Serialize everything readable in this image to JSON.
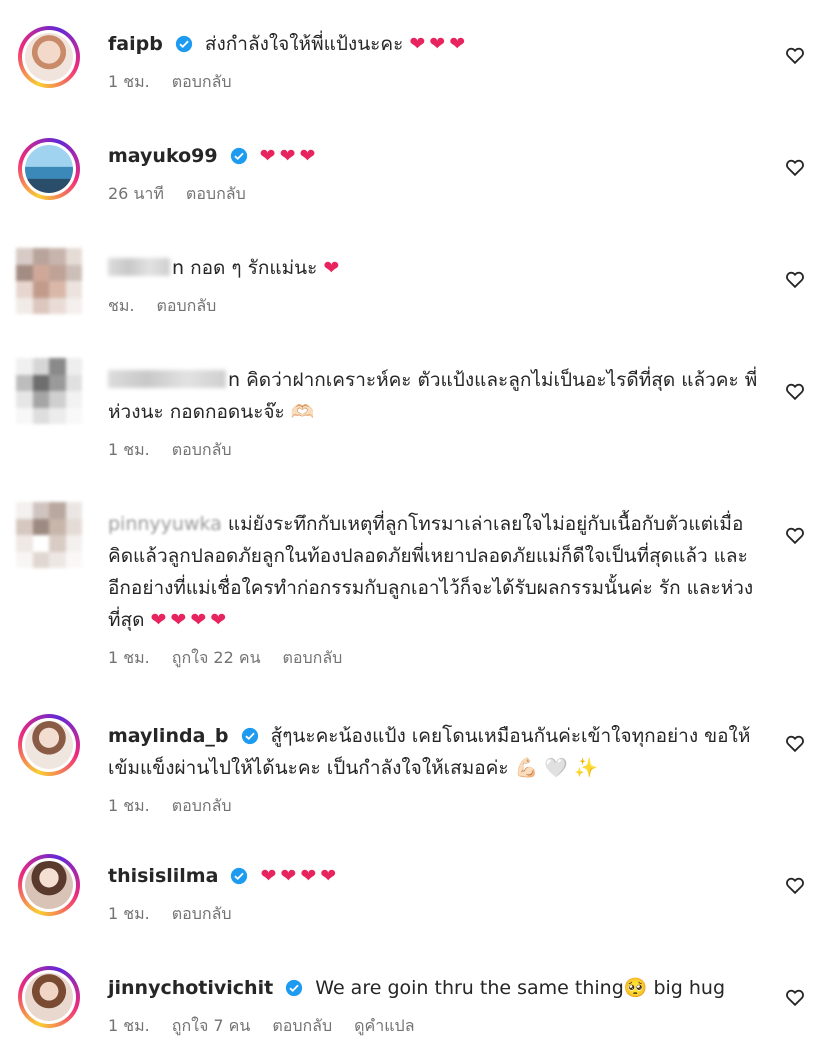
{
  "colors": {
    "heart": "#e8245e",
    "verified": "#1d9bf0",
    "meta": "#737373"
  },
  "comments": [
    {
      "username": "faipb",
      "verified": true,
      "text": "ส่งกำลังใจให้พี่แป้งนะคะ",
      "hearts": "❤❤❤",
      "time": "1 ชม.",
      "likes": "",
      "reply": "ตอบกลับ"
    },
    {
      "username": "mayuko99",
      "verified": true,
      "text": "",
      "hearts": "❤❤❤",
      "time": "26 นาที",
      "likes": "",
      "reply": "ตอบกลับ"
    },
    {
      "username": "n",
      "verified": false,
      "text": "กอด ๆ รักแม่นะ",
      "hearts": "❤",
      "time": "ชม.",
      "likes": "",
      "reply": "ตอบกลับ"
    },
    {
      "username": "n",
      "verified": false,
      "text": "คิดว่าฝากเคราะห์คะ ตัวแป้งและลูกไม่เป็นอะไรดีที่สุด แล้วคะ พี่ห่วงนะ กอดกอดนะจ๊ะ 🫶🏻",
      "hearts": "",
      "time": "1 ชม.",
      "likes": "",
      "reply": "ตอบกลับ"
    },
    {
      "username": "pinnyyuwka",
      "verified": false,
      "text": "แม่ยังระทึกกับเหตุที่ลูกโทรมาเล่าเลยใจไม่อยู่กับเนื้อกับตัวแต่เมื่อคิดแล้วลูกปลอดภัยลูกในท้องปลอดภัยพี่เหยาปลอดภัยแม่ก็ดีใจเป็นที่สุดแล้ว และอีกอย่างที่แม่เชื่อใครทำก่อกรรมกับลูกเอาไว้ก็จะได้รับผลกรรมนั้นค่ะ รัก และห่วงที่สุด",
      "hearts": "❤❤❤❤",
      "time": "1 ชม.",
      "likes": "ถูกใจ 22 คน",
      "reply": "ตอบกลับ"
    },
    {
      "username": "maylinda_b",
      "verified": true,
      "text": "สู้ๆนะคะน้องแป้ง เคยโดนเหมือนกันค่ะเข้าใจทุกอย่าง ขอให้เข้มแข็งผ่านไปให้ได้นะคะ เป็นกำลังใจให้เสมอค่ะ 💪🏻 🤍 ✨",
      "hearts": "",
      "time": "1 ชม.",
      "likes": "",
      "reply": "ตอบกลับ"
    },
    {
      "username": "thisislilma",
      "verified": true,
      "text": "",
      "hearts": "❤❤❤❤",
      "time": "1 ชม.",
      "likes": "",
      "reply": "ตอบกลับ"
    },
    {
      "username": "jinnychotivichit",
      "verified": true,
      "text": "We are goin thru the same thing🥺  big hug",
      "hearts": "",
      "time": "1 ชม.",
      "likes": "ถูกใจ 7 คน",
      "reply": "ตอบกลับ",
      "translate": "ดูคำแปล"
    }
  ]
}
